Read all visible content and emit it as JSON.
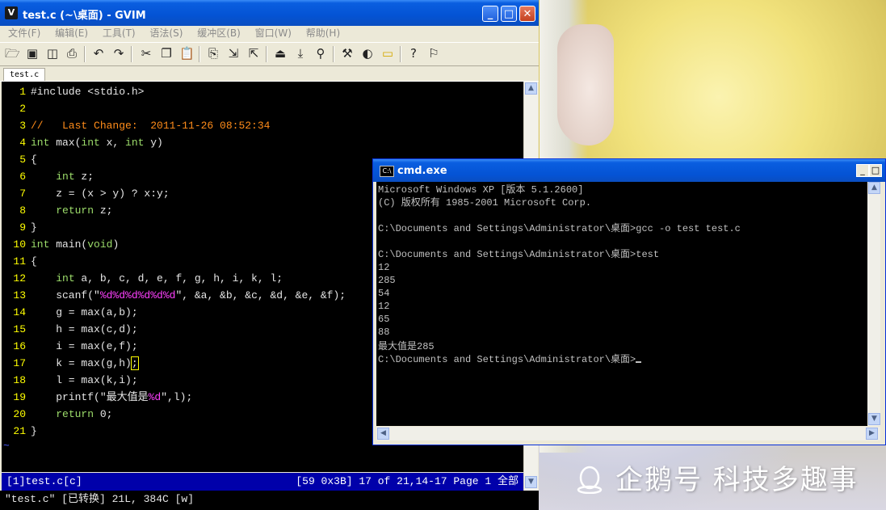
{
  "gvim": {
    "title": "test.c (~\\桌面) - GVIM",
    "menu": [
      "文件(F)",
      "编辑(E)",
      "工具(T)",
      "语法(S)",
      "缓冲区(B)",
      "窗口(W)",
      "帮助(H)"
    ],
    "toolbar_icons": [
      "open-icon",
      "save-icon",
      "save-all-icon",
      "print-icon",
      "undo-icon",
      "redo-icon",
      "cut-icon",
      "copy-icon",
      "paste-icon",
      "find-replace-icon",
      "find-next-icon",
      "find-prev-icon",
      "load-session-icon",
      "save-session-icon",
      "run-script-icon",
      "make-icon",
      "shell-icon",
      "tags-icon",
      "help-icon",
      "find-help-icon"
    ],
    "tab": "test.c",
    "lines": [
      {
        "n": "1",
        "parts": [
          {
            "c": "pre",
            "t": "#include <stdio.h>"
          }
        ]
      },
      {
        "n": "2",
        "parts": []
      },
      {
        "n": "3",
        "parts": [
          {
            "c": "cmt",
            "t": "//   Last Change:  2011-11-26 08:52:34"
          }
        ]
      },
      {
        "n": "4",
        "parts": [
          {
            "c": "kw",
            "t": "int"
          },
          {
            "c": "norm",
            "t": " max("
          },
          {
            "c": "kw",
            "t": "int"
          },
          {
            "c": "norm",
            "t": " x, "
          },
          {
            "c": "kw",
            "t": "int"
          },
          {
            "c": "norm",
            "t": " y)"
          }
        ]
      },
      {
        "n": "5",
        "parts": [
          {
            "c": "norm",
            "t": "{"
          }
        ]
      },
      {
        "n": "6",
        "parts": [
          {
            "c": "norm",
            "t": "    "
          },
          {
            "c": "kw",
            "t": "int"
          },
          {
            "c": "norm",
            "t": " z;"
          }
        ]
      },
      {
        "n": "7",
        "parts": [
          {
            "c": "norm",
            "t": "    z = (x > y) ? x:y;"
          }
        ]
      },
      {
        "n": "8",
        "parts": [
          {
            "c": "norm",
            "t": "    "
          },
          {
            "c": "kw",
            "t": "return"
          },
          {
            "c": "norm",
            "t": " z;"
          }
        ]
      },
      {
        "n": "9",
        "parts": [
          {
            "c": "norm",
            "t": "}"
          }
        ]
      },
      {
        "n": "10",
        "parts": [
          {
            "c": "kw",
            "t": "int"
          },
          {
            "c": "norm",
            "t": " main("
          },
          {
            "c": "kw",
            "t": "void"
          },
          {
            "c": "norm",
            "t": ")"
          }
        ]
      },
      {
        "n": "11",
        "parts": [
          {
            "c": "norm",
            "t": "{"
          }
        ]
      },
      {
        "n": "12",
        "parts": [
          {
            "c": "norm",
            "t": "    "
          },
          {
            "c": "kw",
            "t": "int"
          },
          {
            "c": "norm",
            "t": " a, b, c, d, e, f, g, h, i, k, l;"
          }
        ]
      },
      {
        "n": "13",
        "parts": [
          {
            "c": "norm",
            "t": "    scanf(\""
          },
          {
            "c": "str",
            "t": "%d%d%d%d%d%d"
          },
          {
            "c": "norm",
            "t": "\", &a, &b, &c, &d, &e, &f);"
          }
        ]
      },
      {
        "n": "14",
        "parts": [
          {
            "c": "norm",
            "t": "    g = max(a,b);"
          }
        ]
      },
      {
        "n": "15",
        "parts": [
          {
            "c": "norm",
            "t": "    h = max(c,d);"
          }
        ]
      },
      {
        "n": "16",
        "parts": [
          {
            "c": "norm",
            "t": "    i = max(e,f);"
          }
        ]
      },
      {
        "n": "17",
        "parts": [
          {
            "c": "norm",
            "t": "    k = max(g,h)"
          },
          {
            "c": "cur",
            "t": ";"
          }
        ]
      },
      {
        "n": "18",
        "parts": [
          {
            "c": "norm",
            "t": "    l = max(k,i);"
          }
        ]
      },
      {
        "n": "19",
        "parts": [
          {
            "c": "norm",
            "t": "    printf(\"最大值是"
          },
          {
            "c": "str",
            "t": "%d"
          },
          {
            "c": "norm",
            "t": "\",l);"
          }
        ]
      },
      {
        "n": "20",
        "parts": [
          {
            "c": "norm",
            "t": "    "
          },
          {
            "c": "kw",
            "t": "return"
          },
          {
            "c": "norm",
            "t": " 0;"
          }
        ]
      },
      {
        "n": "21",
        "parts": [
          {
            "c": "norm",
            "t": "}"
          }
        ]
      }
    ],
    "tilde": "~",
    "statusline_left": "[1]test.c[c]",
    "statusline_right": "[59 0x3B] 17 of 21,14-17 Page 1 全部",
    "cmdline": "\"test.c\" [已转换] 21L, 384C [w]"
  },
  "cmd": {
    "title": "cmd.exe",
    "lines": [
      "Microsoft Windows XP [版本 5.1.2600]",
      "(C) 版权所有 1985-2001 Microsoft Corp.",
      "",
      "C:\\Documents and Settings\\Administrator\\桌面>gcc -o test test.c",
      "",
      "C:\\Documents and Settings\\Administrator\\桌面>test",
      "12",
      "285",
      "54",
      "12",
      "65",
      "88",
      "最大值是285",
      "C:\\Documents and Settings\\Administrator\\桌面>"
    ]
  },
  "watermark": "企鹅号 科技多趣事"
}
